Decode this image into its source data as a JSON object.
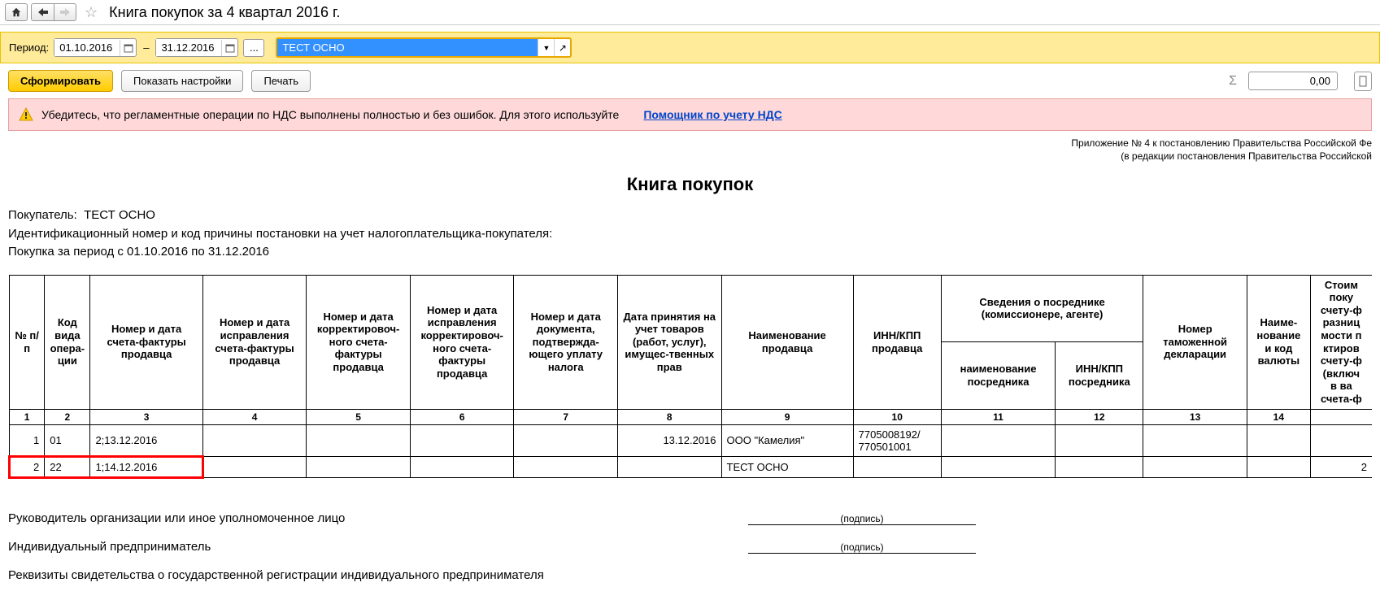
{
  "nav": {
    "title": "Книга покупок за 4 квартал 2016 г."
  },
  "filter": {
    "period_label": "Период:",
    "date_from": "01.10.2016",
    "date_to": "31.12.2016",
    "dash": "–",
    "dots": "...",
    "org_value": "ТЕСТ ОСНО"
  },
  "actions": {
    "generate": "Сформировать",
    "show_settings": "Показать настройки",
    "print": "Печать",
    "sum_value": "0,00"
  },
  "warning": {
    "text": "Убедитесь, что регламентные операции по НДС выполнены полностью и без ошибок. Для этого используйте",
    "link": "Помощник по учету НДС"
  },
  "report": {
    "legal1": "Приложение № 4 к постановлению Правительства Российской Фе",
    "legal2": "(в редакции постановления Правительства Российской",
    "title": "Книга покупок",
    "buyer_label": "Покупатель:",
    "buyer_value": "ТЕСТ ОСНО",
    "idn_line": "Идентификационный номер и код причины постановки на учет налогоплательщика-покупателя:",
    "period_line": "Покупка за период с 01.10.2016 по 31.12.2016"
  },
  "headers": {
    "h1": "№ п/п",
    "h2": "Код вида опера-ции",
    "h3": "Номер и дата счета-фактуры продавца",
    "h4": "Номер и дата исправления счета-фактуры продавца",
    "h5": "Номер и дата корректировоч-ного счета-фактуры продавца",
    "h6": "Номер и дата исправления корректировоч-ного счета-фактуры продавца",
    "h7": "Номер и дата документа, подтвержда-ющего уплату налога",
    "h8": "Дата принятия на учет товаров (работ, услуг), имущес-твенных прав",
    "h9": "Наименование продавца",
    "h10": "ИНН/КПП продавца",
    "h11_12": "Сведения о посреднике (комиссионере, агенте)",
    "h11": "наименование посредника",
    "h12": "ИНН/КПП посредника",
    "h13": "Номер таможенной декларации",
    "h14": "Наиме-нование и код валюты",
    "h15": "Стоим\nпоку\nсчету-ф\nразниц\nмости п\nктиров\nсчету-ф\n(включ\nв ва\nсчета-ф",
    "n1": "1",
    "n2": "2",
    "n3": "3",
    "n4": "4",
    "n5": "5",
    "n6": "6",
    "n7": "7",
    "n8": "8",
    "n9": "9",
    "n10": "10",
    "n11": "11",
    "n12": "12",
    "n13": "13",
    "n14": "14"
  },
  "rows": [
    {
      "n": "1",
      "code": "01",
      "inv": "2;13.12.2016",
      "c4": "",
      "c5": "",
      "c6": "",
      "c7": "",
      "accept": "13.12.2016",
      "seller": "ООО \"Камелия\"",
      "inn": "7705008192/\n770501001",
      "c11": "",
      "c12": "",
      "c13": "",
      "c14": "",
      "c15": ""
    },
    {
      "n": "2",
      "code": "22",
      "inv": "1;14.12.2016",
      "c4": "",
      "c5": "",
      "c6": "",
      "c7": "",
      "accept": "",
      "seller": "ТЕСТ ОСНО",
      "inn": "",
      "c11": "",
      "c12": "",
      "c13": "",
      "c14": "",
      "c15": "2"
    }
  ],
  "sigs": {
    "s1": "Руководитель организации или иное уполномоченное лицо",
    "s2": "Индивидуальный предприниматель",
    "s3": "Реквизиты свидетельства о государственной регистрации индивидуального предпринимателя",
    "caption": "(подпись)"
  }
}
